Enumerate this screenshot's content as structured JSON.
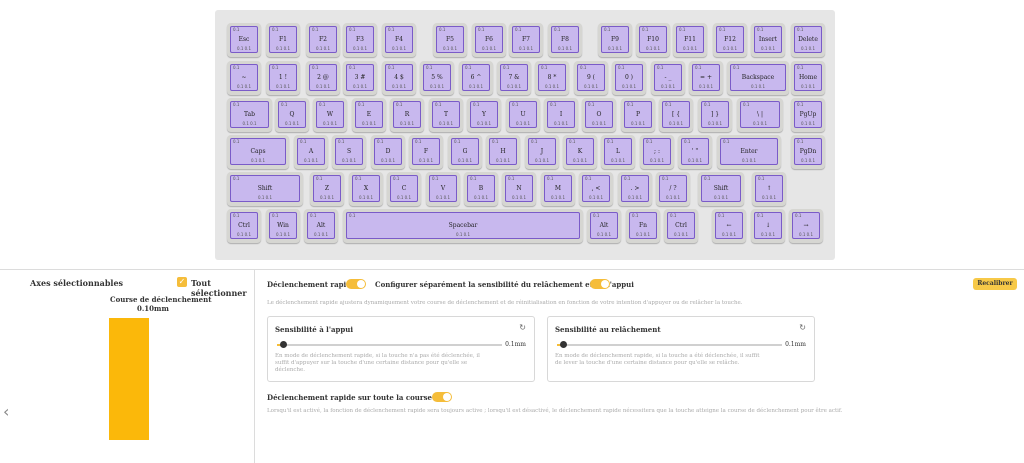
{
  "keyboard": {
    "switch_tag": "0.1",
    "travel_tag": "0.1 0.1",
    "rows": [
      [
        "Esc",
        "F1",
        "F2",
        "F3",
        "F4",
        "F5",
        "F6",
        "F7",
        "F8",
        "F9",
        "F10",
        "F11",
        "F12",
        "Insert",
        "Delete"
      ],
      [
        "~",
        "1 !",
        "2 @",
        "3 #",
        "4 $",
        "5 %",
        "6 ^",
        "7 &",
        "8 *",
        "9 (",
        "0 )",
        "- _",
        "= +",
        "Backspace",
        "Home"
      ],
      [
        "Tab",
        "Q",
        "W",
        "E",
        "R",
        "T",
        "Y",
        "U",
        "I",
        "O",
        "P",
        "[ {",
        "] }",
        "\\ |",
        "PgUp"
      ],
      [
        "Caps",
        "A",
        "S",
        "D",
        "F",
        "G",
        "H",
        "J",
        "K",
        "L",
        "; :",
        "' \"",
        "Enter",
        "PgDn"
      ],
      [
        "Shift",
        "Z",
        "X",
        "C",
        "V",
        "B",
        "N",
        "M",
        ", <",
        ". >",
        "/ ?",
        "Shift",
        "↑"
      ],
      [
        "Ctrl",
        "Win",
        "Alt",
        "Spacebar",
        "Alt",
        "Fn",
        "Ctrl",
        "←",
        "↓",
        "→"
      ]
    ]
  },
  "left_panel": {
    "title": "Axes sélectionnables",
    "select_all_label": "Tout sélectionner",
    "select_all_checked": true,
    "course_title": "Course de déclenchement",
    "course_value": "0.10mm",
    "bar_color": "#fbb80a"
  },
  "right_panel": {
    "rapid_trigger_label": "Déclenchement rapide",
    "rapid_trigger_on": true,
    "separate_label": "Configurer séparément la sensibilité du relâchement et de l'appui",
    "separate_on": true,
    "recalibrate_label": "Recalibrer",
    "rapid_trigger_desc": "Le déclenchement rapide ajustera dynamiquement votre course de déclenchement et de réinitialisation en fonction de votre intention d'appuyer ou de relâcher la touche.",
    "press_card": {
      "title": "Sensibilité à l'appui",
      "value": "0.1mm",
      "desc": "En mode de déclenchement rapide, si la touche n'a pas été déclenchée, il suffit d'appuyer sur la touche d'une certaine distance pour qu'elle se déclenche."
    },
    "release_card": {
      "title": "Sensibilité au relâchement",
      "value": "0.1mm",
      "desc": "En mode de déclenchement rapide, si la touche a été déclenchée, il suffit de lever la touche d'une certaine distance pour qu'elle se relâche."
    },
    "full_course_label": "Déclenchement rapide sur toute la course",
    "full_course_on": true,
    "full_course_desc": "Lorsqu'il est activé, la fonction de déclenchement rapide sera toujours active ; lorsqu'il est désactivé, le déclenchement rapide nécessitera que la touche atteigne la course de déclenchement pour être actif."
  },
  "colors": {
    "accent": "#f5bd3a",
    "key_fill": "#c8b8ee",
    "key_border": "#7a5bc8"
  }
}
